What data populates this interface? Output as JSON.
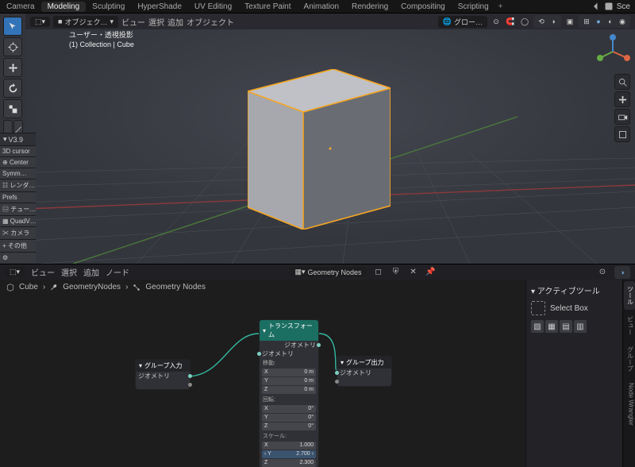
{
  "workspaces": [
    "Camera",
    "Modeling",
    "Sculpting",
    "HyperShade",
    "UV Editing",
    "Texture Paint",
    "Animation",
    "Rendering",
    "Compositing",
    "Scripting"
  ],
  "active_workspace": 1,
  "top_right": {
    "scene_label": "Sce"
  },
  "viewport": {
    "editor_mode": "オブジェク…",
    "menus": [
      "ビュー",
      "選択",
      "追加",
      "オブジェクト"
    ],
    "right_dropdown": "グロー…",
    "context_line1": "ユーザー・透視投影",
    "context_line2": "(1) Collection | Cube"
  },
  "side_panel": {
    "header": "V3.9",
    "items": [
      "3D cursor",
      "Center",
      "Symm…",
      "レンダ…",
      "Prefs",
      "チュー…",
      "QuadV…",
      "カメラ",
      "その他",
      ""
    ]
  },
  "node_editor": {
    "menus": [
      "ビュー",
      "選択",
      "追加",
      "ノード"
    ],
    "tree_name": "Geometry Nodes",
    "breadcrumb": [
      "Cube",
      "GeometryNodes",
      "Geometry Nodes"
    ],
    "group_input": {
      "title": "グループ入力",
      "socket": "ジオメトリ"
    },
    "group_output": {
      "title": "グループ出力",
      "socket": "ジオメトリ"
    },
    "transform": {
      "title": "トランスフォーム",
      "geo": "ジオメトリ",
      "sections": {
        "translate": "移動:",
        "rotate": "回転:",
        "scale": "スケール:"
      },
      "translate": [
        [
          "X",
          "0 m"
        ],
        [
          "Y",
          "0 m"
        ],
        [
          "Z",
          "0 m"
        ]
      ],
      "rotate": [
        [
          "X",
          "0°"
        ],
        [
          "Y",
          "0°"
        ],
        [
          "Z",
          "0°"
        ]
      ],
      "scale": [
        [
          "X",
          "1.000"
        ],
        [
          "Y",
          "2.700"
        ],
        [
          "Z",
          "2.300"
        ]
      ],
      "active_scale_index": 1
    },
    "right_panel": {
      "title": "アクティブツール",
      "select_box": "Select Box"
    },
    "vtabs": [
      "ツール",
      "ビュー",
      "グループ",
      "Node Wrangler"
    ]
  }
}
